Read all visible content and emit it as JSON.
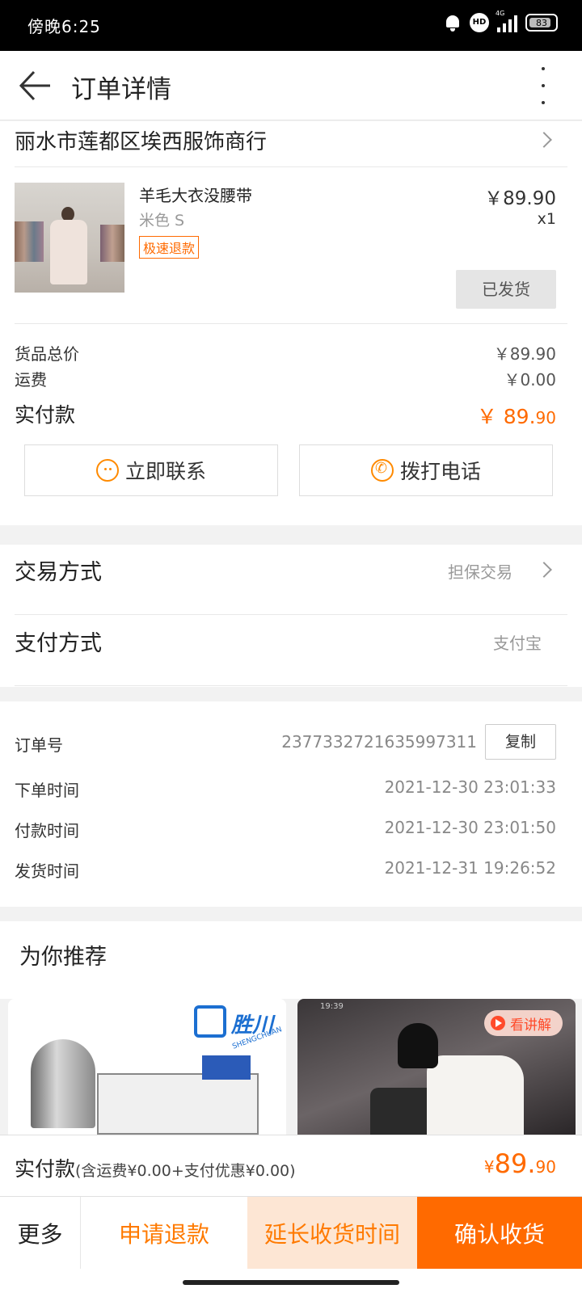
{
  "status_bar": {
    "time": "傍晚6:25",
    "network": "4G",
    "battery": "83"
  },
  "header": {
    "title": "订单详情"
  },
  "shop": {
    "name": "丽水市莲都区埃西服饰商行"
  },
  "product": {
    "name": "羊毛大衣没腰带",
    "spec": "米色 S",
    "tag": "极速退款",
    "price": "￥89.90",
    "qty": "x1",
    "status_button": "已发货"
  },
  "price_summary": {
    "goods_label": "货品总价",
    "goods_value": "￥89.90",
    "shipping_label": "运费",
    "shipping_value": "￥0.00",
    "actual_label": "实付款",
    "actual_symbol": "￥",
    "actual_int": "89.",
    "actual_dec": "90"
  },
  "contact": {
    "chat_label": "立即联系",
    "call_label": "拨打电话"
  },
  "trade": {
    "trade_label": "交易方式",
    "trade_value": "担保交易",
    "pay_label": "支付方式",
    "pay_value": "支付宝"
  },
  "order": {
    "no_label": "订单号",
    "no_value": "2377332721635997311",
    "copy_label": "复制",
    "created_label": "下单时间",
    "created_value": "2021-12-30 23:01:33",
    "paid_label": "付款时间",
    "paid_value": "2021-12-30 23:01:50",
    "shipped_label": "发货时间",
    "shipped_value": "2021-12-31 19:26:52"
  },
  "recommend": {
    "title": "为你推荐",
    "left_logo_text": "胜川",
    "left_logo_sub": "SHENGCHUAN",
    "right_badge": "看讲解",
    "right_time": "19:39"
  },
  "pay_summary": {
    "label": "实付款",
    "detail": "(含运费¥0.00+支付优惠¥0.00)",
    "symbol": "¥",
    "int": "89.",
    "dec": "90"
  },
  "bottom_bar": {
    "more": "更多",
    "refund": "申请退款",
    "extend": "延长收货时间",
    "confirm": "确认收货"
  },
  "colors": {
    "accent": "#ff6a00",
    "accent_light": "#fde6d4"
  }
}
